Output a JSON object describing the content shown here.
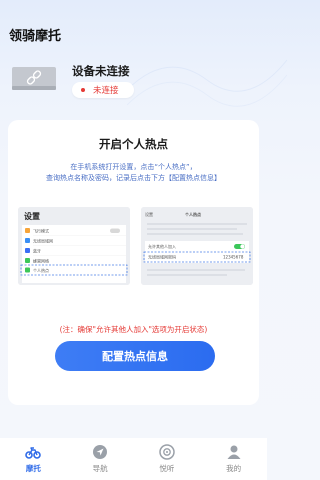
{
  "header": {
    "title": "领骑摩托"
  },
  "device": {
    "name": "设备未连接",
    "status": "未连接",
    "icon": "link-broken-icon"
  },
  "hotspot_card": {
    "title": "开启个人热点",
    "desc_line1": "在手机系统打开设置，点击“个人热点”，",
    "desc_line2": "查询热点名称及密码，记录后点击下方【配置热点信息】",
    "left_shot": {
      "title": "设置",
      "items": [
        "飞行模式",
        "无线局域网",
        "蓝牙",
        "蜂窝网络",
        "个人热点"
      ]
    },
    "right_shot": {
      "back": "设置",
      "title": "个人热点",
      "allow_label": "允许其他人加入",
      "password_label": "无线局域网密码",
      "password_value": "12345678"
    },
    "note": "(注：确保\"允许其他人加入\"选项为开启状态)",
    "button_label": "配置热点信息"
  },
  "tabbar": {
    "items": [
      {
        "label": "摩托",
        "icon": "motorcycle-icon",
        "active": true
      },
      {
        "label": "导航",
        "icon": "navigation-icon",
        "active": false
      },
      {
        "label": "悦听",
        "icon": "music-icon",
        "active": false
      },
      {
        "label": "我的",
        "icon": "user-icon",
        "active": false
      }
    ]
  },
  "colors": {
    "accent": "#2f6be8",
    "danger": "#e53935",
    "hint": "#4a6fc5"
  }
}
